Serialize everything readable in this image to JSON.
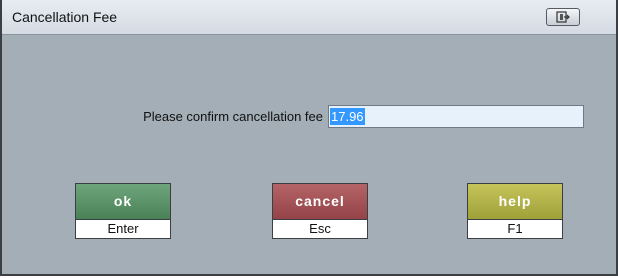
{
  "window": {
    "title": "Cancellation Fee",
    "restore_icon": "window-restore-icon"
  },
  "prompt": {
    "label": "Please confirm cancellation fee",
    "fee_value": "17.96"
  },
  "buttons": {
    "ok": {
      "label": "ok",
      "key": "Enter",
      "color": "#5a9467"
    },
    "cancel": {
      "label": "cancel",
      "key": "Esc",
      "color": "#a4555a"
    },
    "help": {
      "label": "help",
      "key": "F1",
      "color": "#b3b34a"
    }
  },
  "colors": {
    "background": "#a3aeb7",
    "input_background": "#e6f1fb",
    "selection": "#3399ff"
  }
}
